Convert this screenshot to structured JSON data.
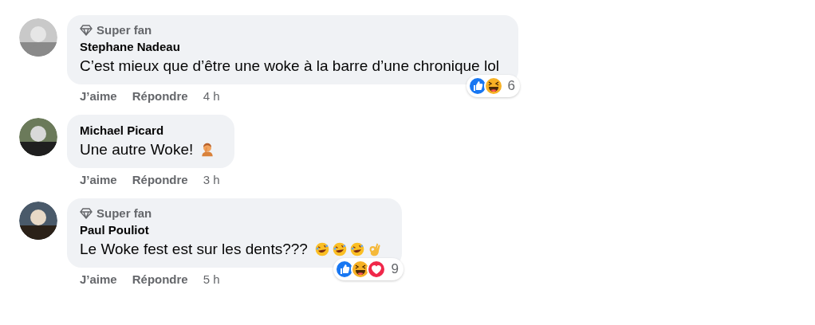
{
  "comments": [
    {
      "badge": "Super fan",
      "author": "Stephane Nadeau",
      "text": "C’est mieux que d’être une woke à la barre d’une chronique lol",
      "reactions": [
        {
          "kind": "like"
        },
        {
          "kind": "haha"
        }
      ],
      "reaction_count": "6",
      "like": "J’aime",
      "reply": "Répondre",
      "time": "4 h"
    },
    {
      "author": "Michael Picard",
      "text": "Une autre Woke!",
      "trailing_icons": [
        {
          "kind": "facepalm"
        }
      ],
      "like": "J’aime",
      "reply": "Répondre",
      "time": "3 h"
    },
    {
      "badge": "Super fan",
      "author": "Paul Pouliot",
      "text": "Le Woke fest est sur les dents???",
      "trailing_icons": [
        {
          "kind": "rofl"
        },
        {
          "kind": "rofl"
        },
        {
          "kind": "rofl"
        },
        {
          "kind": "ok"
        }
      ],
      "reactions": [
        {
          "kind": "like"
        },
        {
          "kind": "haha"
        },
        {
          "kind": "love"
        }
      ],
      "reaction_count": "9",
      "like": "J’aime",
      "reply": "Répondre",
      "time": "5 h"
    }
  ]
}
